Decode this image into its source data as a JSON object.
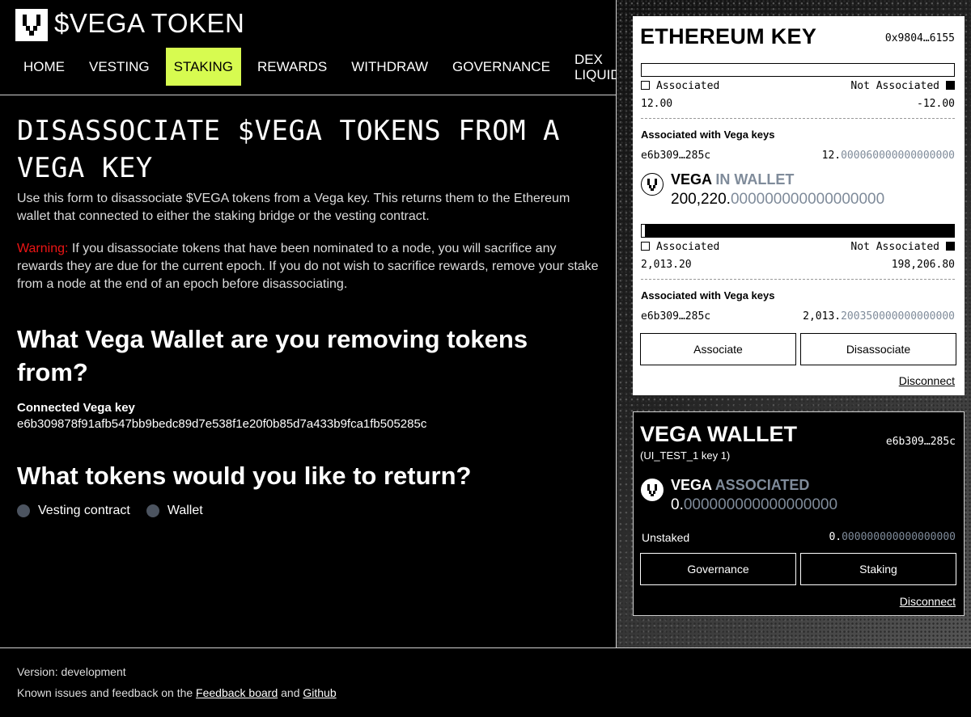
{
  "header": {
    "app_title": "$VEGA TOKEN",
    "nav": [
      {
        "label": "HOME"
      },
      {
        "label": "VESTING"
      },
      {
        "label": "STAKING",
        "active": true
      },
      {
        "label": "REWARDS"
      },
      {
        "label": "WITHDRAW"
      },
      {
        "label": "GOVERNANCE"
      },
      {
        "label": "DEX LIQUIDITY"
      }
    ]
  },
  "main": {
    "title": "DISASSOCIATE $VEGA TOKENS FROM A VEGA KEY",
    "intro": "Use this form to disassociate $VEGA tokens from a Vega key. This returns them to the Ethereum wallet that connected to either the staking bridge or the vesting contract.",
    "warning_label": "Warning:",
    "warning_text": " If you disassociate tokens that have been nominated to a node, you will sacrifice any rewards they are due for the current epoch. If you do not wish to sacrifice rewards, remove your stake from a node at the end of an epoch before disassociating.",
    "wallet_question": "What Vega Wallet are you removing tokens from?",
    "connected_label": "Connected Vega key",
    "connected_key": "e6b309878f91afb547bb9bedc89d7e538f1e20f0b85d7a433b9fca1fb505285c",
    "tokens_question": "What tokens would you like to return?",
    "options": [
      "Vesting contract",
      "Wallet"
    ]
  },
  "eth_card": {
    "title": "ETHEREUM KEY",
    "address": "0x9804…6155",
    "vesting": {
      "associated_label": "Associated",
      "not_associated_label": "Not Associated",
      "associated_value": "12.00",
      "not_associated_value": "-12.00",
      "associated_fraction": 0.0,
      "keys_heading": "Associated with Vega keys",
      "key": "e6b309…285c",
      "key_amount_int": "12.",
      "key_amount_dec": "000060000000000000"
    },
    "wallet_token": {
      "name": "VEGA",
      "tag": "IN WALLET",
      "amount_int": "200,220.",
      "amount_dec": "000000000000000000"
    },
    "wallet": {
      "associated_label": "Associated",
      "not_associated_label": "Not Associated",
      "associated_value": "2,013.20",
      "not_associated_value": "198,206.80",
      "associated_fraction": 0.01,
      "keys_heading": "Associated with Vega keys",
      "key": "e6b309…285c",
      "key_amount_int": "2,013.",
      "key_amount_dec": "200350000000000000"
    },
    "associate_btn": "Associate",
    "disassociate_btn": "Disassociate",
    "disconnect": "Disconnect"
  },
  "vega_card": {
    "title": "VEGA WALLET",
    "subtitle": "(UI_TEST_1 key 1)",
    "key": "e6b309…285c",
    "token_name": "VEGA",
    "token_tag": "ASSOCIATED",
    "amount_int": "0.",
    "amount_dec": "000000000000000000",
    "unstaked_label": "Unstaked",
    "unstaked_int": "0.",
    "unstaked_dec": "000000000000000000",
    "governance_btn": "Governance",
    "staking_btn": "Staking",
    "disconnect": "Disconnect"
  },
  "footer": {
    "version": "Version: development",
    "feedback_prefix": "Known issues and feedback on the ",
    "feedback_link": "Feedback board",
    "and": " and ",
    "github_link": "Github"
  },
  "colors": {
    "accent": "#d7fb50",
    "warning": "#ed1515",
    "muted_decimal": "#7f8b9a"
  }
}
